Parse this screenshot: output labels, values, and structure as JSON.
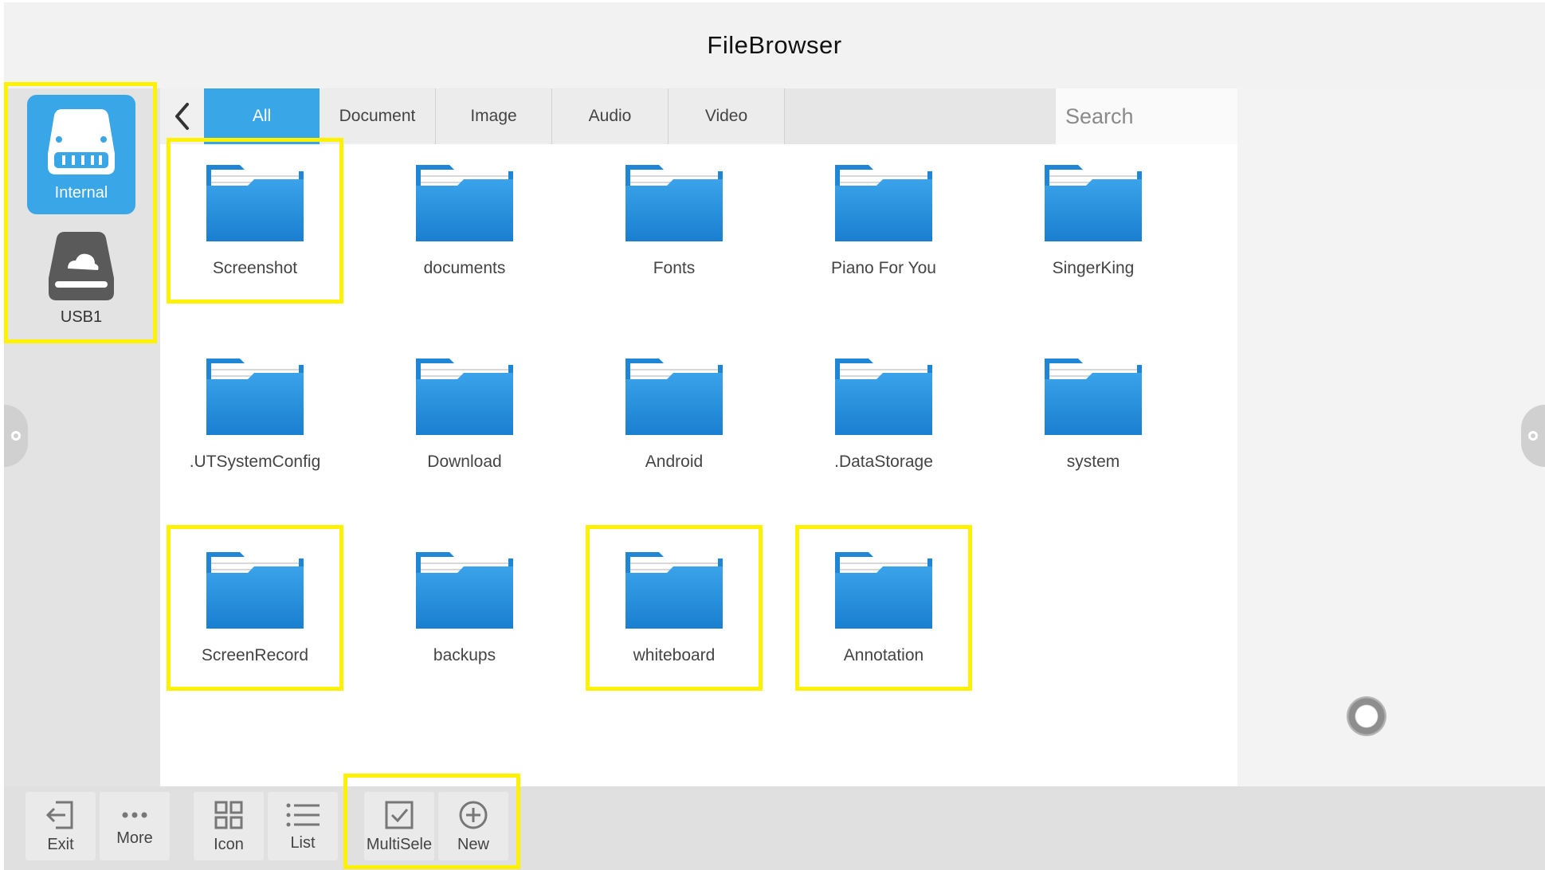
{
  "app": {
    "title": "FileBrowser"
  },
  "sidebar": {
    "devices": [
      {
        "label": "Internal",
        "icon": "internal-storage-icon",
        "active": true
      },
      {
        "label": "USB1",
        "icon": "usb-drive-icon",
        "active": false
      }
    ]
  },
  "tabs": [
    {
      "label": "All",
      "active": true
    },
    {
      "label": "Document",
      "active": false
    },
    {
      "label": "Image",
      "active": false
    },
    {
      "label": "Audio",
      "active": false
    },
    {
      "label": "Video",
      "active": false
    }
  ],
  "search": {
    "placeholder": "Search",
    "value": ""
  },
  "folders": [
    {
      "name": "Screenshot",
      "highlighted": true
    },
    {
      "name": "documents",
      "highlighted": false
    },
    {
      "name": "Fonts",
      "highlighted": false
    },
    {
      "name": "Piano For You",
      "highlighted": false
    },
    {
      "name": "SingerKing",
      "highlighted": false
    },
    {
      "name": ".UTSystemConfig",
      "highlighted": false
    },
    {
      "name": "Download",
      "highlighted": false
    },
    {
      "name": "Android",
      "highlighted": false
    },
    {
      "name": ".DataStorage",
      "highlighted": false
    },
    {
      "name": "system",
      "highlighted": false
    },
    {
      "name": "ScreenRecord",
      "highlighted": true
    },
    {
      "name": "backups",
      "highlighted": false
    },
    {
      "name": "whiteboard",
      "highlighted": true
    },
    {
      "name": "Annotation",
      "highlighted": true
    }
  ],
  "toolbar": {
    "exit_label": "Exit",
    "more_label": "More",
    "icon_label": "Icon",
    "list_label": "List",
    "multiselect_label": "MultiSele",
    "new_label": "New"
  },
  "colors": {
    "accent": "#39a6e8",
    "highlight": "#fff200",
    "folder_blue": "#1f87d6"
  }
}
